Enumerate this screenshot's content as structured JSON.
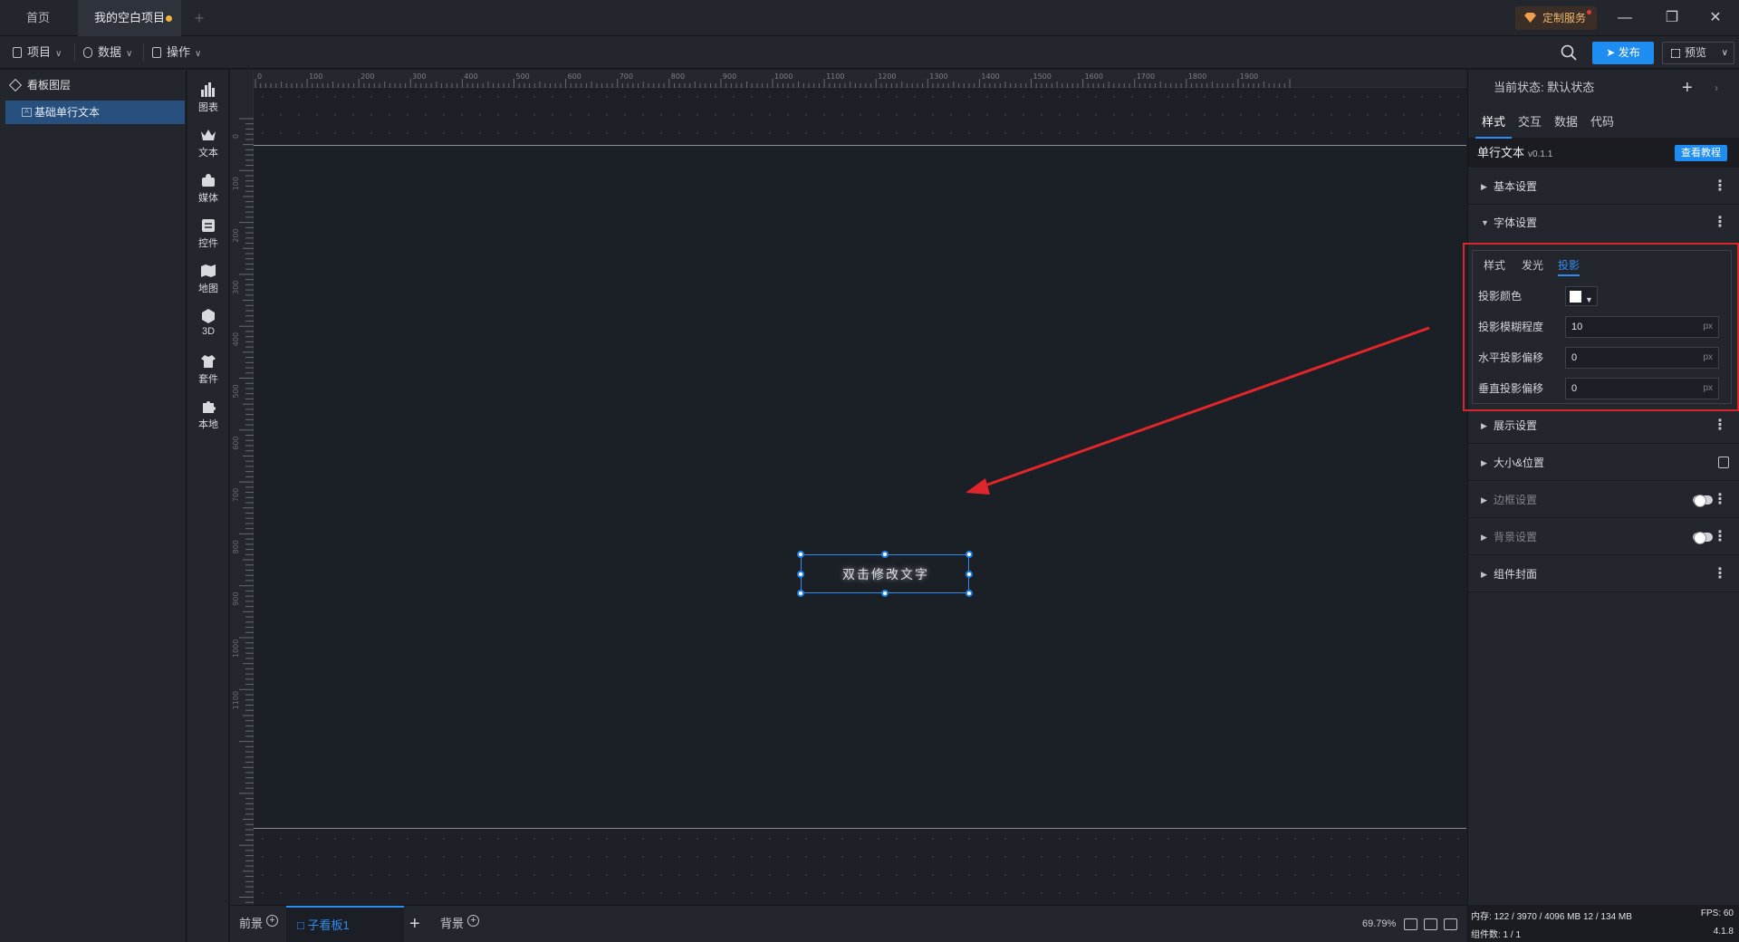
{
  "titlebar": {
    "tab_home": "首页",
    "tab_project": "我的空白项目",
    "custom_service": "定制服务"
  },
  "menubar": {
    "project": "项目",
    "data": "数据",
    "ops": "操作",
    "publish": "发布",
    "preview": "预览"
  },
  "layers": {
    "header": "看板图层",
    "item": "基础单行文本"
  },
  "toolbar": {
    "items": [
      "图表",
      "文本",
      "媒体",
      "控件",
      "地图",
      "3D",
      "套件",
      "本地"
    ]
  },
  "ruler": {
    "top": [
      "0",
      "100",
      "200",
      "300",
      "400",
      "500",
      "600",
      "700",
      "800",
      "900",
      "1000",
      "1100",
      "1200",
      "1300",
      "1400",
      "1500",
      "1600",
      "1700",
      "1800",
      "1900"
    ],
    "left": [
      "0",
      "100",
      "200",
      "300",
      "400",
      "500",
      "600",
      "700",
      "800",
      "900",
      "1000",
      "1100"
    ]
  },
  "canvas": {
    "selected_text": "双击修改文字"
  },
  "bottombar": {
    "front": "前景",
    "sub": "子看板1",
    "back": "背景",
    "zoom": "69.79%"
  },
  "rightpanel": {
    "state": "当前状态:  默认状态",
    "tabs": [
      "样式",
      "交互",
      "数据",
      "代码"
    ],
    "comp_name": "单行文本",
    "comp_version": "v0.1.1",
    "tutorial": "查看教程",
    "sections": {
      "basic": "基本设置",
      "font": "字体设置",
      "display": "展示设置",
      "size_pos": "大小&位置",
      "border": "边框设置",
      "background": "背景设置",
      "cover": "组件封面"
    },
    "font_tabs": [
      "样式",
      "发光",
      "投影"
    ],
    "shadow": {
      "color_label": "投影颜色",
      "blur_label": "投影模糊程度",
      "blur_value": "10",
      "h_label": "水平投影偏移",
      "h_value": "0",
      "v_label": "垂直投影偏移",
      "v_value": "0",
      "unit": "px"
    }
  },
  "status": {
    "mem": "内存:  122 / 3970 / 4096 MB  12 / 134 MB",
    "fps": "FPS:  60",
    "count": "组件数: 1 / 1",
    "version": "4.1.8"
  },
  "colors": {
    "accent": "#1e8cf0",
    "highlight_box": "#d9262b",
    "annotation_arrow": "#e0262b"
  }
}
